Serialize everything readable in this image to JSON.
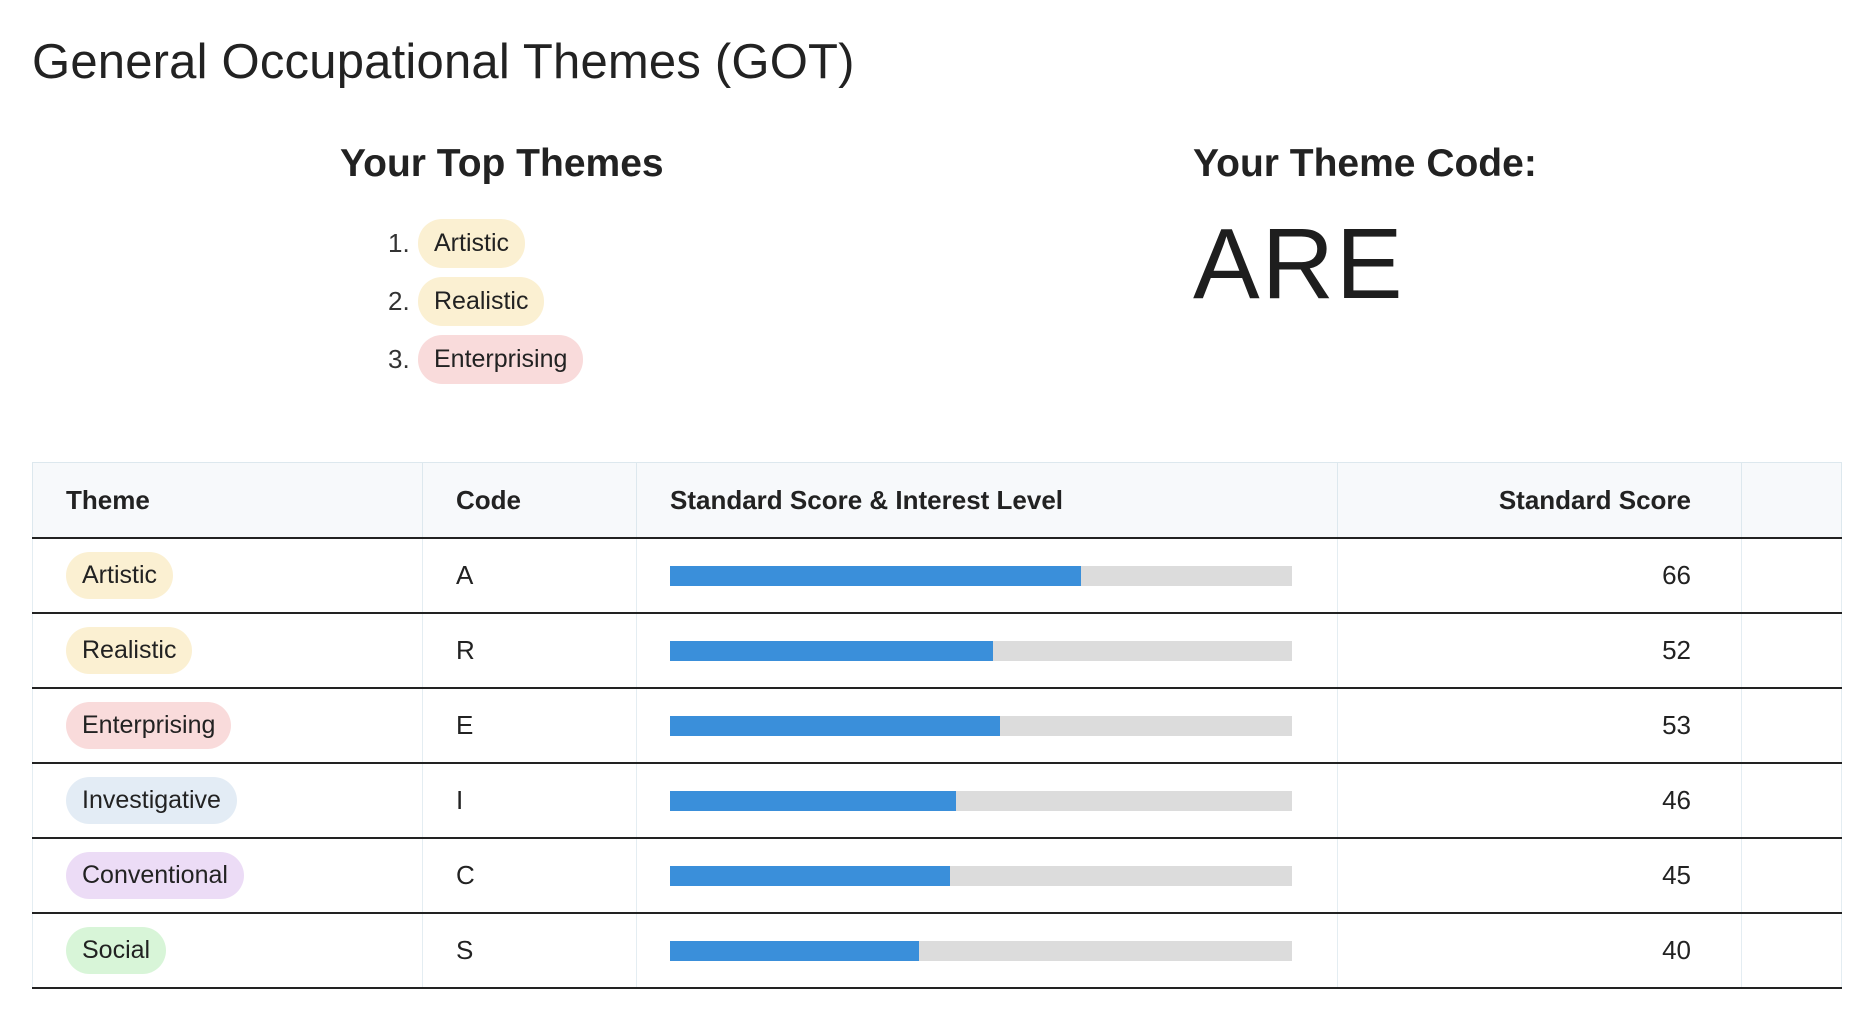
{
  "page": {
    "title": "General Occupational Themes (GOT)"
  },
  "top_themes": {
    "heading": "Your Top Themes",
    "items": [
      {
        "rank": "1.",
        "label": "Artistic",
        "color": "#fbf0d2"
      },
      {
        "rank": "2.",
        "label": "Realistic",
        "color": "#fbf0d2"
      },
      {
        "rank": "3.",
        "label": "Enterprising",
        "color": "#f9dbdb"
      }
    ]
  },
  "theme_code": {
    "heading": "Your Theme Code:",
    "value": "ARE"
  },
  "table": {
    "headers": {
      "theme": "Theme",
      "code": "Code",
      "bar": "Standard Score & Interest Level",
      "score": "Standard Score",
      "extra": ""
    },
    "bar_scale_max": 100,
    "bar_color": "#3a8fda",
    "track_color": "#dcdcdc",
    "rows": [
      {
        "theme": "Artistic",
        "code": "A",
        "score": "66",
        "value": 66,
        "color": "#fbf0d2"
      },
      {
        "theme": "Realistic",
        "code": "R",
        "score": "52",
        "value": 52,
        "color": "#fbf0d2"
      },
      {
        "theme": "Enterprising",
        "code": "E",
        "score": "53",
        "value": 53,
        "color": "#f9dbdb"
      },
      {
        "theme": "Investigative",
        "code": "I",
        "score": "46",
        "value": 46,
        "color": "#e3ecf5"
      },
      {
        "theme": "Conventional",
        "code": "C",
        "score": "45",
        "value": 45,
        "color": "#ecdcf6"
      },
      {
        "theme": "Social",
        "code": "S",
        "score": "40",
        "value": 40,
        "color": "#d8f5d8"
      }
    ]
  }
}
